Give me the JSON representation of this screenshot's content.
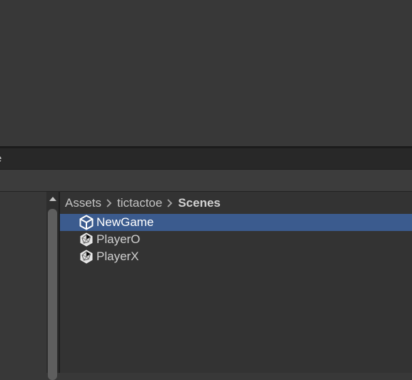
{
  "tab_strip": {
    "partial_label": "e"
  },
  "breadcrumb": [
    {
      "label": "Assets"
    },
    {
      "label": "tictactoe"
    },
    {
      "label": "Scenes"
    }
  ],
  "files": [
    {
      "label": "NewGame",
      "icon": "unity-scene-icon",
      "selected": true
    },
    {
      "label": "PlayerO",
      "icon": "prefab-icon",
      "selected": false
    },
    {
      "label": "PlayerX",
      "icon": "prefab-icon",
      "selected": false
    }
  ],
  "colors": {
    "selection": "#3b5b8e",
    "panel_bg": "#333333",
    "viewport_bg": "#383838"
  }
}
